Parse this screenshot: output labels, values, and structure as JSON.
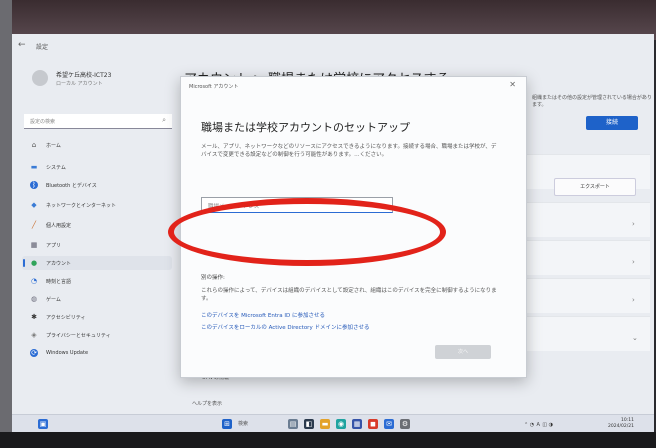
{
  "window": {
    "title": "設定",
    "back": "←"
  },
  "profile": {
    "name": "希望ケ丘高校-ICT23",
    "type": "ローカル アカウント"
  },
  "search": {
    "placeholder": "設定の検索",
    "icon": "search-icon"
  },
  "sidebar": {
    "items": [
      {
        "label": "ホーム",
        "icon": "home-icon"
      },
      {
        "label": "システム",
        "icon": "system-icon"
      },
      {
        "label": "Bluetooth とデバイス",
        "icon": "bluetooth-icon"
      },
      {
        "label": "ネットワークとインターネット",
        "icon": "network-icon"
      },
      {
        "label": "個人用設定",
        "icon": "brush-icon"
      },
      {
        "label": "アプリ",
        "icon": "apps-icon"
      },
      {
        "label": "アカウント",
        "icon": "account-icon",
        "active": true
      },
      {
        "label": "時刻と言語",
        "icon": "clock-icon"
      },
      {
        "label": "ゲーム",
        "icon": "game-icon"
      },
      {
        "label": "アクセシビリティ",
        "icon": "accessibility-icon"
      },
      {
        "label": "プライバシーとセキュリティ",
        "icon": "shield-icon"
      },
      {
        "label": "Windows Update",
        "icon": "update-icon"
      }
    ]
  },
  "main": {
    "heading": "アカウント > 職場または学校にアクセスする",
    "note": "組織またはその他の設定が管理されている場合があります。",
    "connect_button": "接続",
    "export_button": "エクスポート",
    "background_item": "UPN の情報",
    "help_link": "ヘルプを表示"
  },
  "dialog": {
    "title": "Microsoft アカウント",
    "close": "✕",
    "heading": "職場または学校アカウントのセットアップ",
    "description": "メール、アプリ、ネットワークなどのリソースにアクセスできるようになります。接続する場合、職場または学校が、デバイスで変更できる設定などの制御を行う可能性があります。…ください。",
    "email_placeholder": "職場メール アドレス",
    "alt_heading": "別の操作:",
    "alt_description": "これらの操作によって、デバイスは組織のデバイスとして設定され、組織はこのデバイスを完全に制御するようになります。",
    "link_entra": "このデバイスを Microsoft Entra ID に参加させる",
    "link_ad": "このデバイスをローカルの Active Directory ドメインに参加させる",
    "next_button": "次へ"
  },
  "taskbar": {
    "search_label": "検索",
    "clock_time": "10:11",
    "clock_date": "2024/02/21"
  },
  "colors": {
    "accent": "#1e62c9",
    "highlight": "#e2231a"
  }
}
